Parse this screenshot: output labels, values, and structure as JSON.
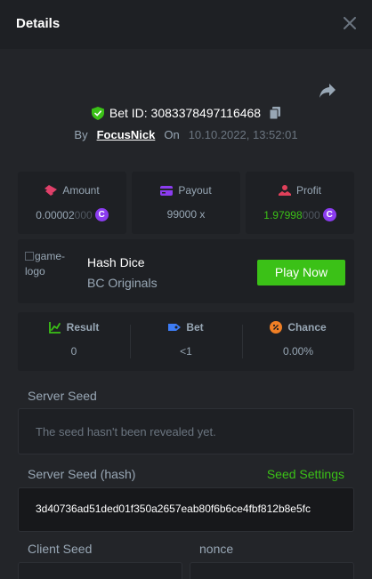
{
  "header": {
    "title": "Details"
  },
  "bet": {
    "id_label": "Bet ID: 3083378497116468",
    "by_label": "By",
    "user": "FocusNick",
    "on_label": "On",
    "date": "10.10.2022, 13:52:01"
  },
  "stats": {
    "amount": {
      "label": "Amount",
      "value_main": "0.00002",
      "value_dim": "000",
      "coin": "C"
    },
    "payout": {
      "label": "Payout",
      "value": "99000 x"
    },
    "profit": {
      "label": "Profit",
      "value_main": "1.97998",
      "value_dim": "000",
      "coin": "C"
    }
  },
  "game": {
    "logo_alt": "game-logo",
    "name": "Hash Dice",
    "provider": "BC Originals",
    "play_label": "Play Now"
  },
  "results": {
    "result": {
      "label": "Result",
      "value": "0"
    },
    "bet": {
      "label": "Bet",
      "value": "<1"
    },
    "chance": {
      "label": "Chance",
      "value": "0.00%"
    }
  },
  "server_seed": {
    "label": "Server Seed",
    "message": "The seed hasn't been revealed yet."
  },
  "server_seed_hash": {
    "label": "Server Seed (hash)",
    "settings_label": "Seed Settings",
    "value": "3d40736ad51ded01f350a2657eab80f6b6ce4fbf812b8e5fc"
  },
  "client_seed": {
    "label": "Client Seed"
  },
  "nonce": {
    "label": "nonce"
  },
  "colors": {
    "accent_green": "#3bc117",
    "coin_purple": "#8b3cf0",
    "amount_pink": "#e0406a",
    "payout_purple": "#8b3cf0",
    "profit_red": "#e0405a",
    "result_green": "#3bc117",
    "bet_blue": "#3d7cf5",
    "chance_orange": "#f07f25"
  }
}
